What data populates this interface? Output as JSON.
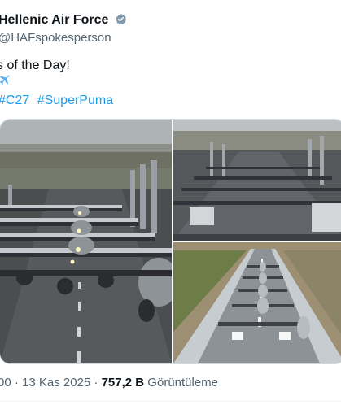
{
  "tweet": {
    "display_name": "Hellenic Air Force",
    "handle": "@HAFspokesperson",
    "text_line": "s of the Day!",
    "hashtags": [
      "#C27",
      "#SuperPuma"
    ],
    "timestamp": "00 · 13 Kas 2025 · ",
    "views_count": "757,2 B",
    "views_label": " Görüntüleme"
  },
  "icons": {
    "verified": "verified-badge-icon",
    "airplane": "airplane-emoji-icon"
  },
  "colors": {
    "link": "#1d9bf0",
    "secondary_text": "#536471",
    "verified_badge": "#1d9bf0"
  }
}
